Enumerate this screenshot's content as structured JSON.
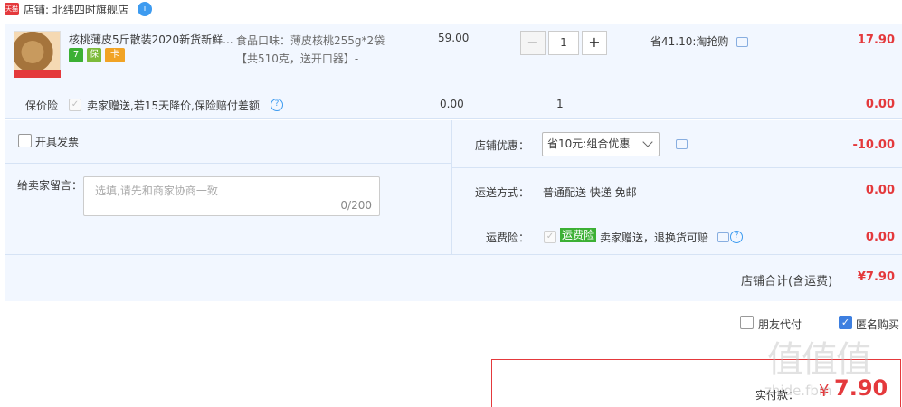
{
  "shop": {
    "badge": "天猫",
    "name": "店铺: 北纬四时旗舰店",
    "chat": "i"
  },
  "item": {
    "title": "核桃薄皮5斤散装2020新货新鲜...",
    "service_badges": [
      "7",
      "保",
      "卡"
    ],
    "sku_line1": "食品口味：薄皮核桃255g*2袋",
    "sku_line2": "【共510克，送开口器】-",
    "unit_price": "59.00",
    "qty_minus": "−",
    "quantity": "1",
    "qty_plus": "+",
    "promotion": "省41.10:淘抢购",
    "subtotal": "17.90"
  },
  "insurance": {
    "label": "保价险",
    "check": "✓",
    "desc": "卖家赠送,若15天降价,保险赔付差额",
    "help": "?",
    "price": "0.00",
    "qty": "1",
    "amount": "0.00"
  },
  "options": {
    "invoice_label": "开具发票",
    "memo_label": "给卖家留言：",
    "memo_placeholder": "选填,请先和商家协商一致",
    "memo_count": "0/200",
    "discount_label": "店铺优惠：",
    "discount_value": "省10元:组合优惠",
    "discount_amount": "-10.00",
    "shipping_label": "运送方式：",
    "shipping_value": "普通配送 快递 免邮",
    "shipping_amount": "0.00",
    "freight_label": "运费险：",
    "freight_check": "✓",
    "freight_tag": "运费险",
    "freight_desc": "卖家赠送，退换货可赔",
    "freight_help": "?",
    "freight_amount": "0.00"
  },
  "total": {
    "label": "店铺合计(含运费)",
    "amount": "¥7.90"
  },
  "extras": {
    "friend_pay": "朋友代付",
    "anonymous": "匿名购买",
    "anonymous_check": "✓"
  },
  "pay": {
    "label": "实付款：",
    "yen": "¥",
    "amount": "7.90"
  },
  "watermark": {
    "logo": "值值值",
    "site": "zhide.fbm"
  },
  "colors": {
    "accent_red": "#e4393c",
    "panel_blue": "#f2f7ff",
    "link_blue": "#3d9bf0"
  }
}
